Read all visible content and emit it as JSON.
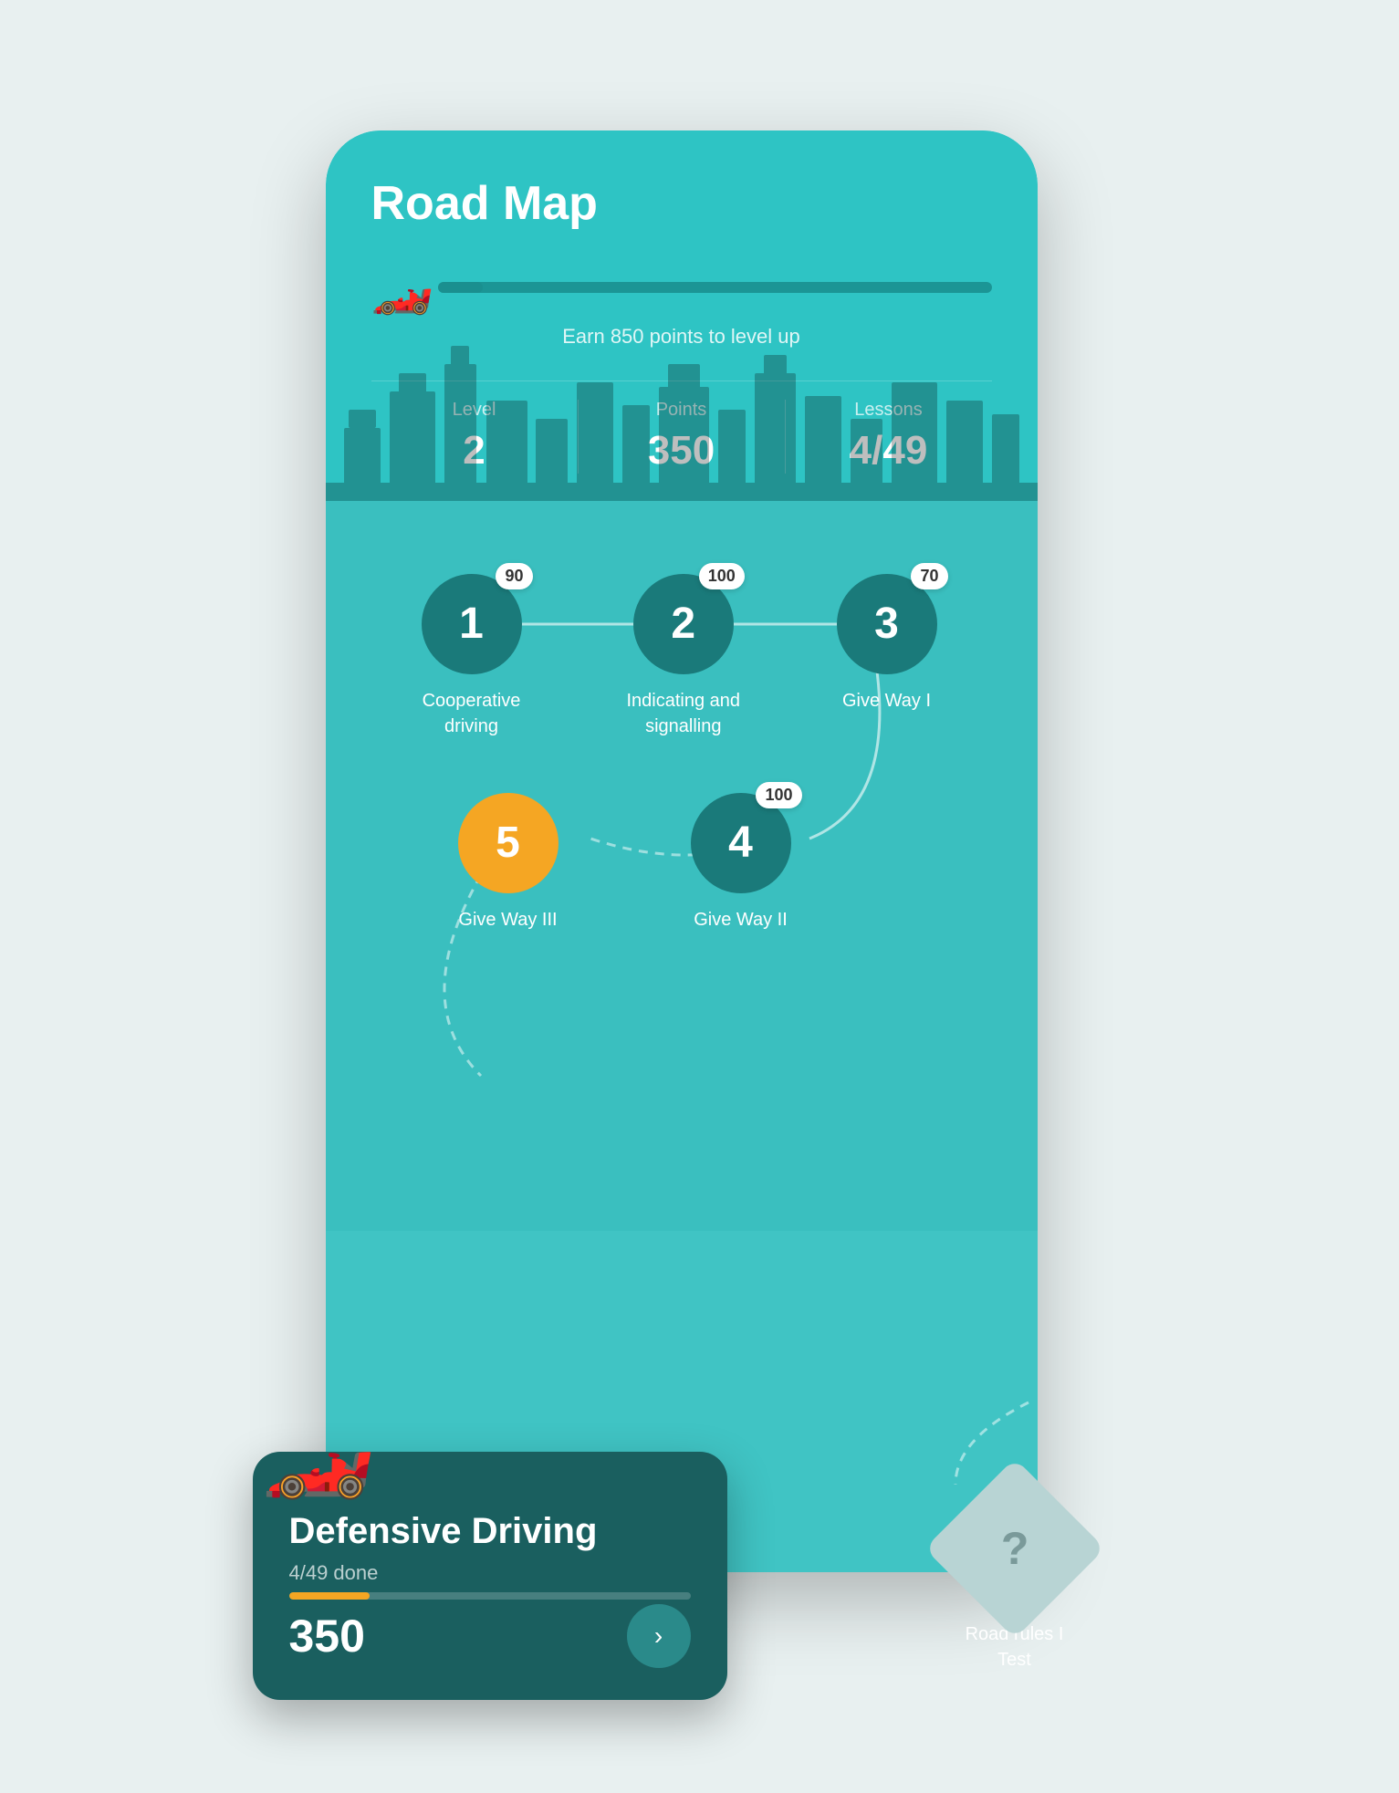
{
  "page": {
    "background_color": "#e8f0f0"
  },
  "roadmap": {
    "title": "Road Map",
    "earn_points_text": "Earn 850 points to level up",
    "progress_percent": 8,
    "stats": {
      "level_label": "Level",
      "level_value": "2",
      "points_label": "Points",
      "points_value": "350",
      "lessons_label": "Lessons",
      "lessons_value": "4/49"
    },
    "nodes": [
      {
        "id": 1,
        "number": "1",
        "badge": "90",
        "label": "Cooperative driving",
        "active": false,
        "row": 1,
        "col": 1
      },
      {
        "id": 2,
        "number": "2",
        "badge": "100",
        "label": "Indicating and signalling",
        "active": false,
        "row": 1,
        "col": 2
      },
      {
        "id": 3,
        "number": "3",
        "badge": "70",
        "label": "Give Way I",
        "active": false,
        "row": 1,
        "col": 3
      },
      {
        "id": 4,
        "number": "4",
        "badge": "100",
        "label": "Give Way II",
        "active": false,
        "row": 2,
        "col": 2
      },
      {
        "id": 5,
        "number": "5",
        "badge": null,
        "label": "Give Way III",
        "active": true,
        "row": 2,
        "col": 1
      }
    ]
  },
  "bottom_card": {
    "title": "Defensive Driving",
    "progress_text": "4/49 done",
    "progress_percent": 20,
    "points": "350",
    "arrow_label": "›"
  },
  "road_rules_card": {
    "icon": "?",
    "label": "Road rules I\nTest"
  }
}
